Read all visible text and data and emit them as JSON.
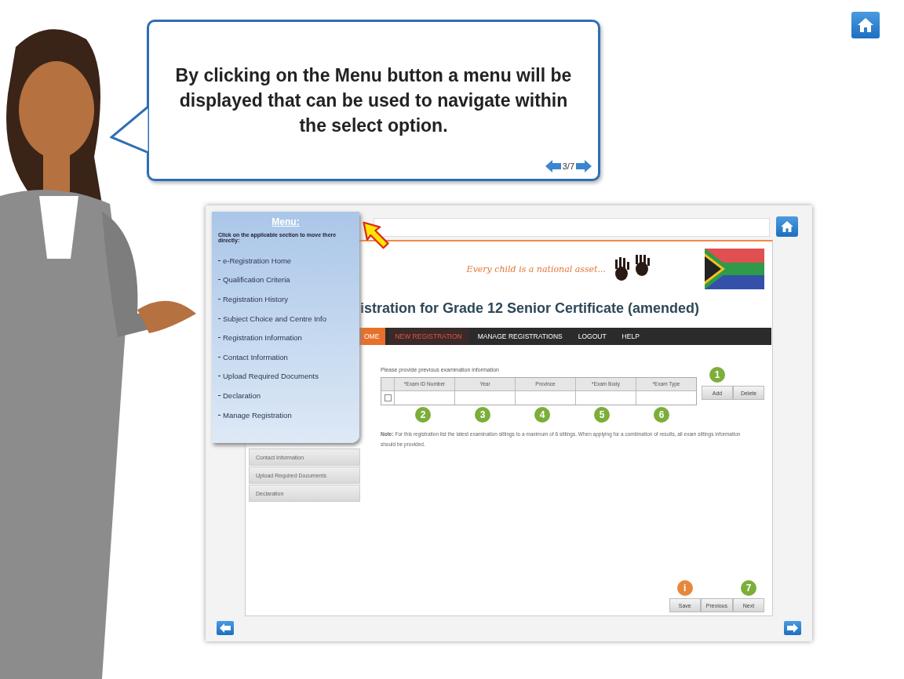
{
  "speech_bubble": {
    "text": "By clicking on the Menu button a menu will be displayed that can be used to navigate within the select option.",
    "page": "3/7"
  },
  "app": {
    "slogan": "Every child is a national asset...",
    "title": "istration for Grade 12 Senior Certificate (amended)",
    "nav": [
      {
        "label": "OME",
        "kind": "home",
        "selected": false
      },
      {
        "label": "NEW REGISTRATION",
        "kind": "link",
        "selected": true
      },
      {
        "label": "MANAGE REGISTRATIONS",
        "kind": "link",
        "selected": false
      },
      {
        "label": "LOGOUT",
        "kind": "link",
        "selected": false
      },
      {
        "label": "HELP",
        "kind": "link",
        "selected": false
      }
    ],
    "sidebar": [
      "Contact Information",
      "Upload Required Documents",
      "Declaration"
    ],
    "form": {
      "instruction": "Please provide previous examination information",
      "columns": [
        {
          "label": "*Exam ID Number",
          "callout": "2"
        },
        {
          "label": "Year",
          "callout": "3"
        },
        {
          "label": "Province",
          "callout": "4"
        },
        {
          "label": "*Exam Body",
          "callout": "5"
        },
        {
          "label": "*Exam Type",
          "callout": "6"
        }
      ],
      "row_checked": false,
      "actions": [
        {
          "label": "Add",
          "callout": "1"
        },
        {
          "label": "Delete"
        }
      ],
      "note": "**Note:** For this registration list the latest examination sittings to a maximum of 6 sittings. When applying for a combination of results, all exam sittings information should be provided."
    },
    "footer_buttons": [
      {
        "label": "Save",
        "callout": "i",
        "color": "#e8873a"
      },
      {
        "label": "Previous"
      },
      {
        "label": "Next",
        "callout": "7",
        "color": "#7cae3a"
      }
    ]
  },
  "menu": {
    "title": "Menu:",
    "intro": "Click on the applicable section to move there directly:",
    "items": [
      "e-Registration Home",
      "Qualification Criteria",
      "Registration History",
      "Subject Choice and Centre Info",
      "Registration Information",
      "Contact Information",
      "Upload Required Documents",
      "Declaration",
      "Manage Registration"
    ]
  }
}
